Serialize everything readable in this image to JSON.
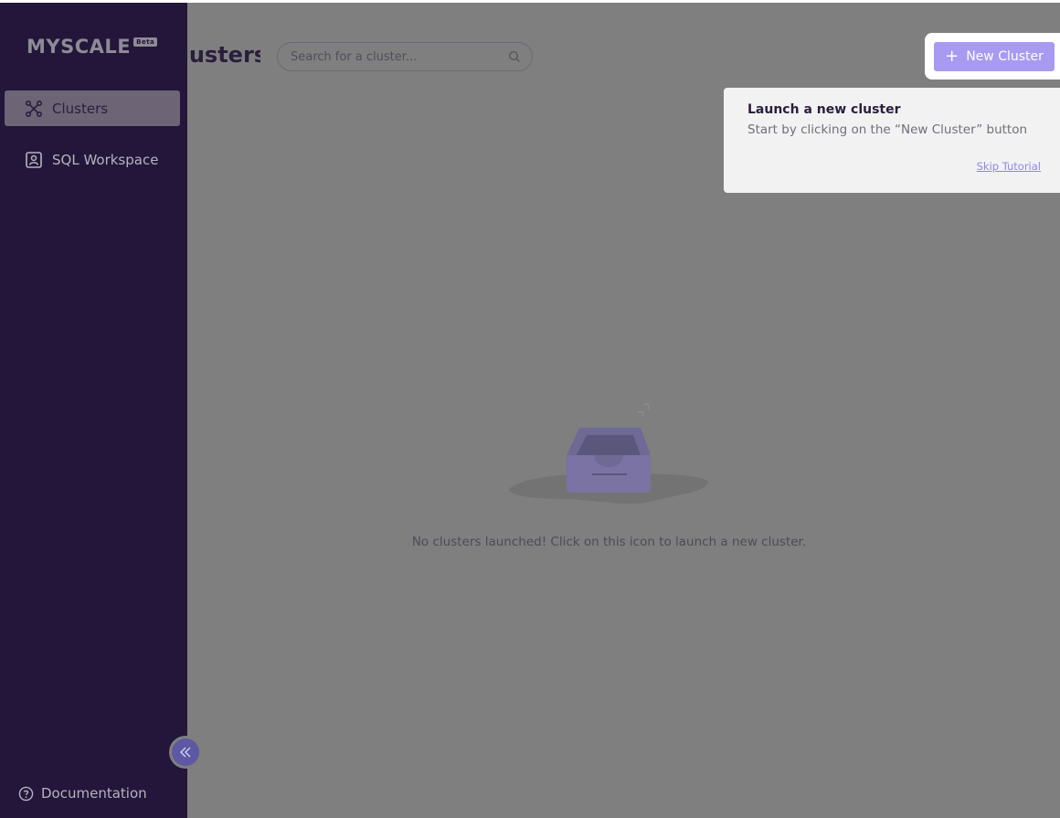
{
  "app": {
    "logo_text": "MYSCALE",
    "logo_badge": "Beta"
  },
  "sidebar": {
    "items": [
      {
        "label": "Clusters",
        "icon": "cluster-icon",
        "active": true
      },
      {
        "label": "SQL Workspace",
        "icon": "sql-workspace-icon",
        "active": false
      }
    ],
    "documentation_label": "Documentation",
    "collapse_icon": "double-chevron-left-icon"
  },
  "header": {
    "title": "Clusters",
    "search_placeholder": "Search for a cluster...",
    "new_cluster_label": "New Cluster"
  },
  "tutorial": {
    "title": "Launch a new cluster",
    "body": "Start by clicking on the “New Cluster” button",
    "skip_label": "Skip Tutorial"
  },
  "empty_state": {
    "message": "No clusters launched! Click on this icon to launch a new cluster."
  },
  "colors": {
    "sidebar_bg": "#23163a",
    "overlay": "#7f7f7f",
    "accent": "#a89af0",
    "link": "#8f86e8"
  }
}
